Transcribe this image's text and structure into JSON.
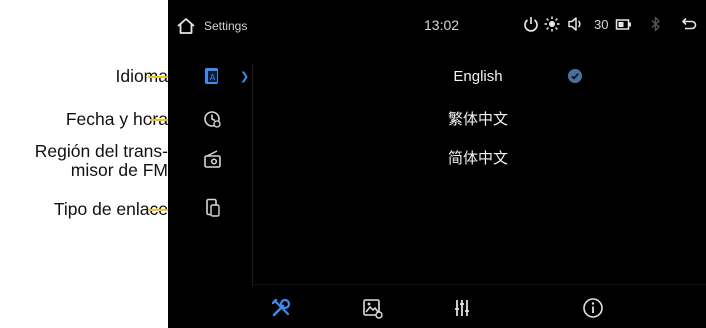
{
  "callouts": {
    "language": "Idioma",
    "datetime": "Fecha y hora",
    "fm_region_line1": "Región del trans-",
    "fm_region_line2": "misor de FM",
    "link_type": "Tipo de enlace"
  },
  "status_bar": {
    "title": "Settings",
    "clock": "13:02",
    "volume": "30",
    "icons": [
      "home-icon",
      "power-icon",
      "brightness-icon",
      "volume-icon",
      "battery-icon",
      "bluetooth-icon",
      "back-icon"
    ]
  },
  "sidebar": {
    "items": [
      {
        "icon": "language-icon",
        "selected": true
      },
      {
        "icon": "clock-icon",
        "selected": false
      },
      {
        "icon": "radio-icon",
        "selected": false
      },
      {
        "icon": "phone-link-icon",
        "selected": false
      }
    ]
  },
  "languages": [
    {
      "label": "English",
      "selected": true
    },
    {
      "label": "繁体中文",
      "selected": false
    },
    {
      "label": "简体中文",
      "selected": false
    }
  ],
  "bottom_tabs": [
    {
      "icon": "tools-icon",
      "active": true
    },
    {
      "icon": "wallpaper-icon",
      "active": false
    },
    {
      "icon": "equalizer-icon",
      "active": false
    },
    {
      "icon": "info-icon",
      "active": false
    }
  ],
  "colors": {
    "accent": "#3d8bf0",
    "callout_line": "#f2c318",
    "screen_bg": "#000000"
  }
}
